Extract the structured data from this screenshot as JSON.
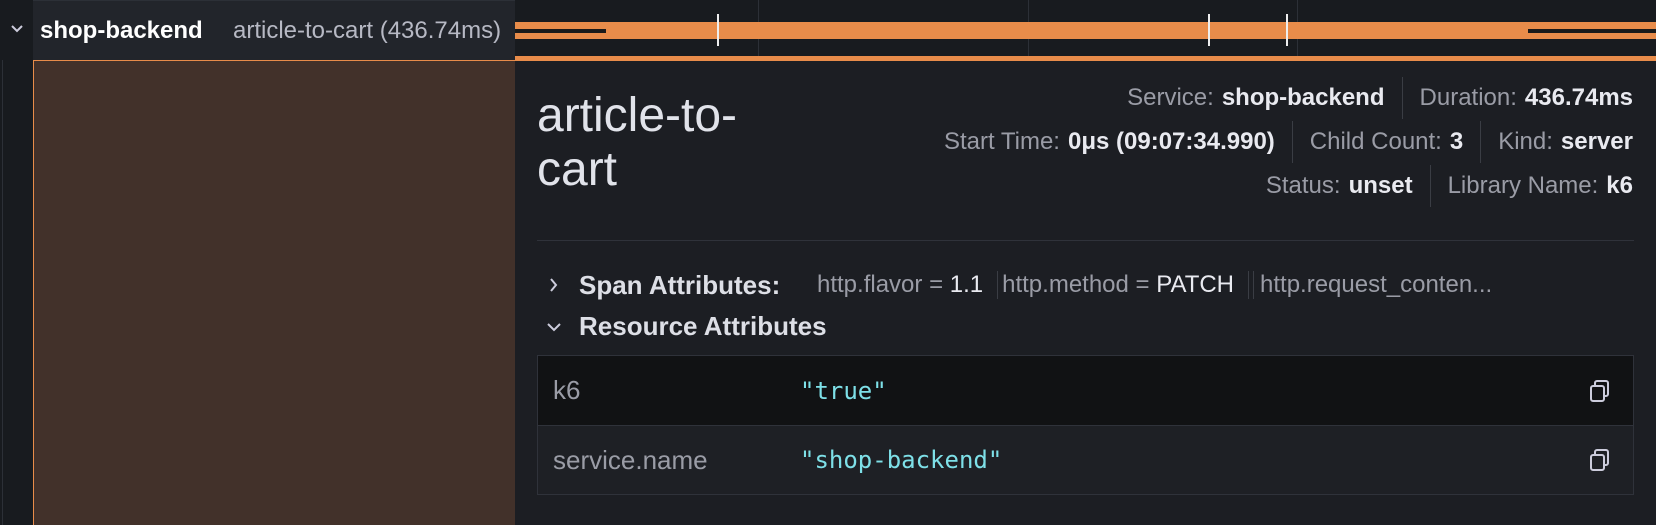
{
  "row": {
    "service_name": "shop-backend",
    "span_summary": "article-to-cart (436.74ms)"
  },
  "detail": {
    "title": "article-to-cart",
    "meta": [
      [
        {
          "label": "Service:",
          "value": "shop-backend"
        },
        {
          "label": "Duration:",
          "value": "436.74ms"
        }
      ],
      [
        {
          "label": "Start Time:",
          "value": "0μs (09:07:34.990)"
        },
        {
          "label": "Child Count:",
          "value": "3"
        },
        {
          "label": "Kind:",
          "value": "server"
        }
      ],
      [
        {
          "label": "Status:",
          "value": "unset"
        },
        {
          "label": "Library Name:",
          "value": "k6"
        }
      ]
    ],
    "span_attributes": {
      "label": "Span Attributes:",
      "items": [
        {
          "key": "http.flavor",
          "eq": "=",
          "value": "1.1"
        },
        {
          "key": "http.method",
          "eq": "=",
          "value": "PATCH"
        }
      ],
      "truncated": "http.request_conten..."
    },
    "resource_attributes": {
      "label": "Resource Attributes",
      "rows": [
        {
          "key": "k6",
          "value": "\"true\""
        },
        {
          "key": "service.name",
          "value": "\"shop-backend\""
        }
      ]
    }
  },
  "colors": {
    "accent": "#e88c4a",
    "selected_bg": "#42312a",
    "value_mono": "#7ee0e8"
  },
  "icons": [
    "chevron-down-icon",
    "chevron-right-icon",
    "copy-icon"
  ]
}
